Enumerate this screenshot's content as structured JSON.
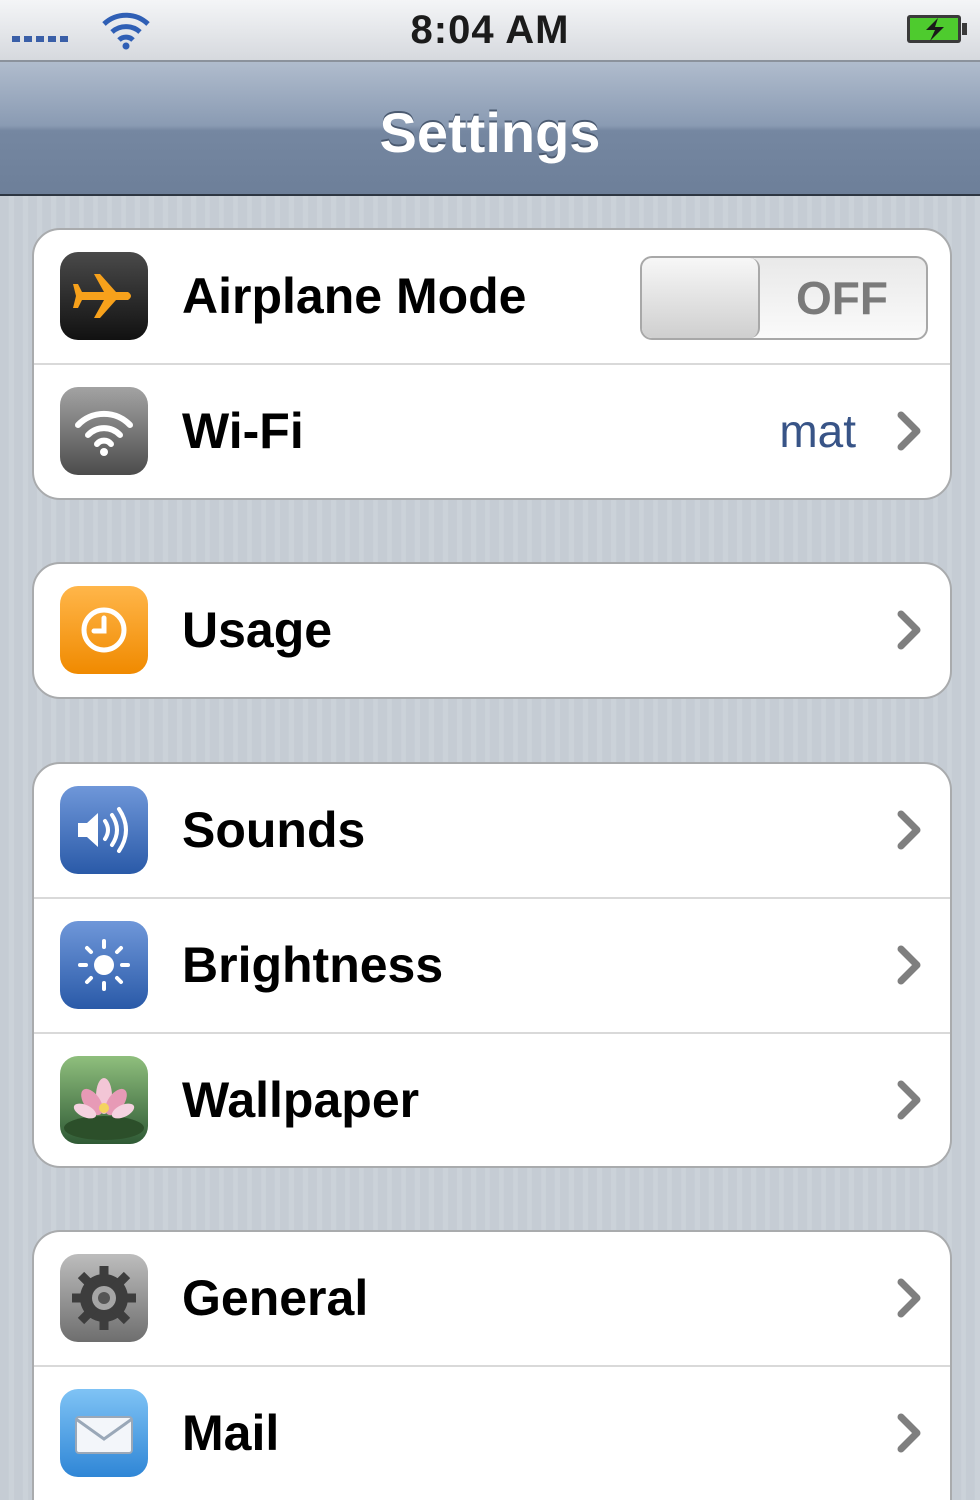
{
  "status_bar": {
    "time": "8:04 AM"
  },
  "navbar": {
    "title": "Settings"
  },
  "groups": [
    {
      "rows": [
        {
          "label": "Airplane Mode",
          "icon": "airplane-icon",
          "toggle": "OFF"
        },
        {
          "label": "Wi-Fi",
          "icon": "wifi-icon",
          "value": "mat"
        }
      ]
    },
    {
      "rows": [
        {
          "label": "Usage",
          "icon": "clock-icon"
        }
      ]
    },
    {
      "rows": [
        {
          "label": "Sounds",
          "icon": "speaker-icon"
        },
        {
          "label": "Brightness",
          "icon": "sun-icon"
        },
        {
          "label": "Wallpaper",
          "icon": "flower-icon"
        }
      ]
    },
    {
      "rows": [
        {
          "label": "General",
          "icon": "gear-icon"
        },
        {
          "label": "Mail",
          "icon": "envelope-icon"
        }
      ]
    }
  ]
}
